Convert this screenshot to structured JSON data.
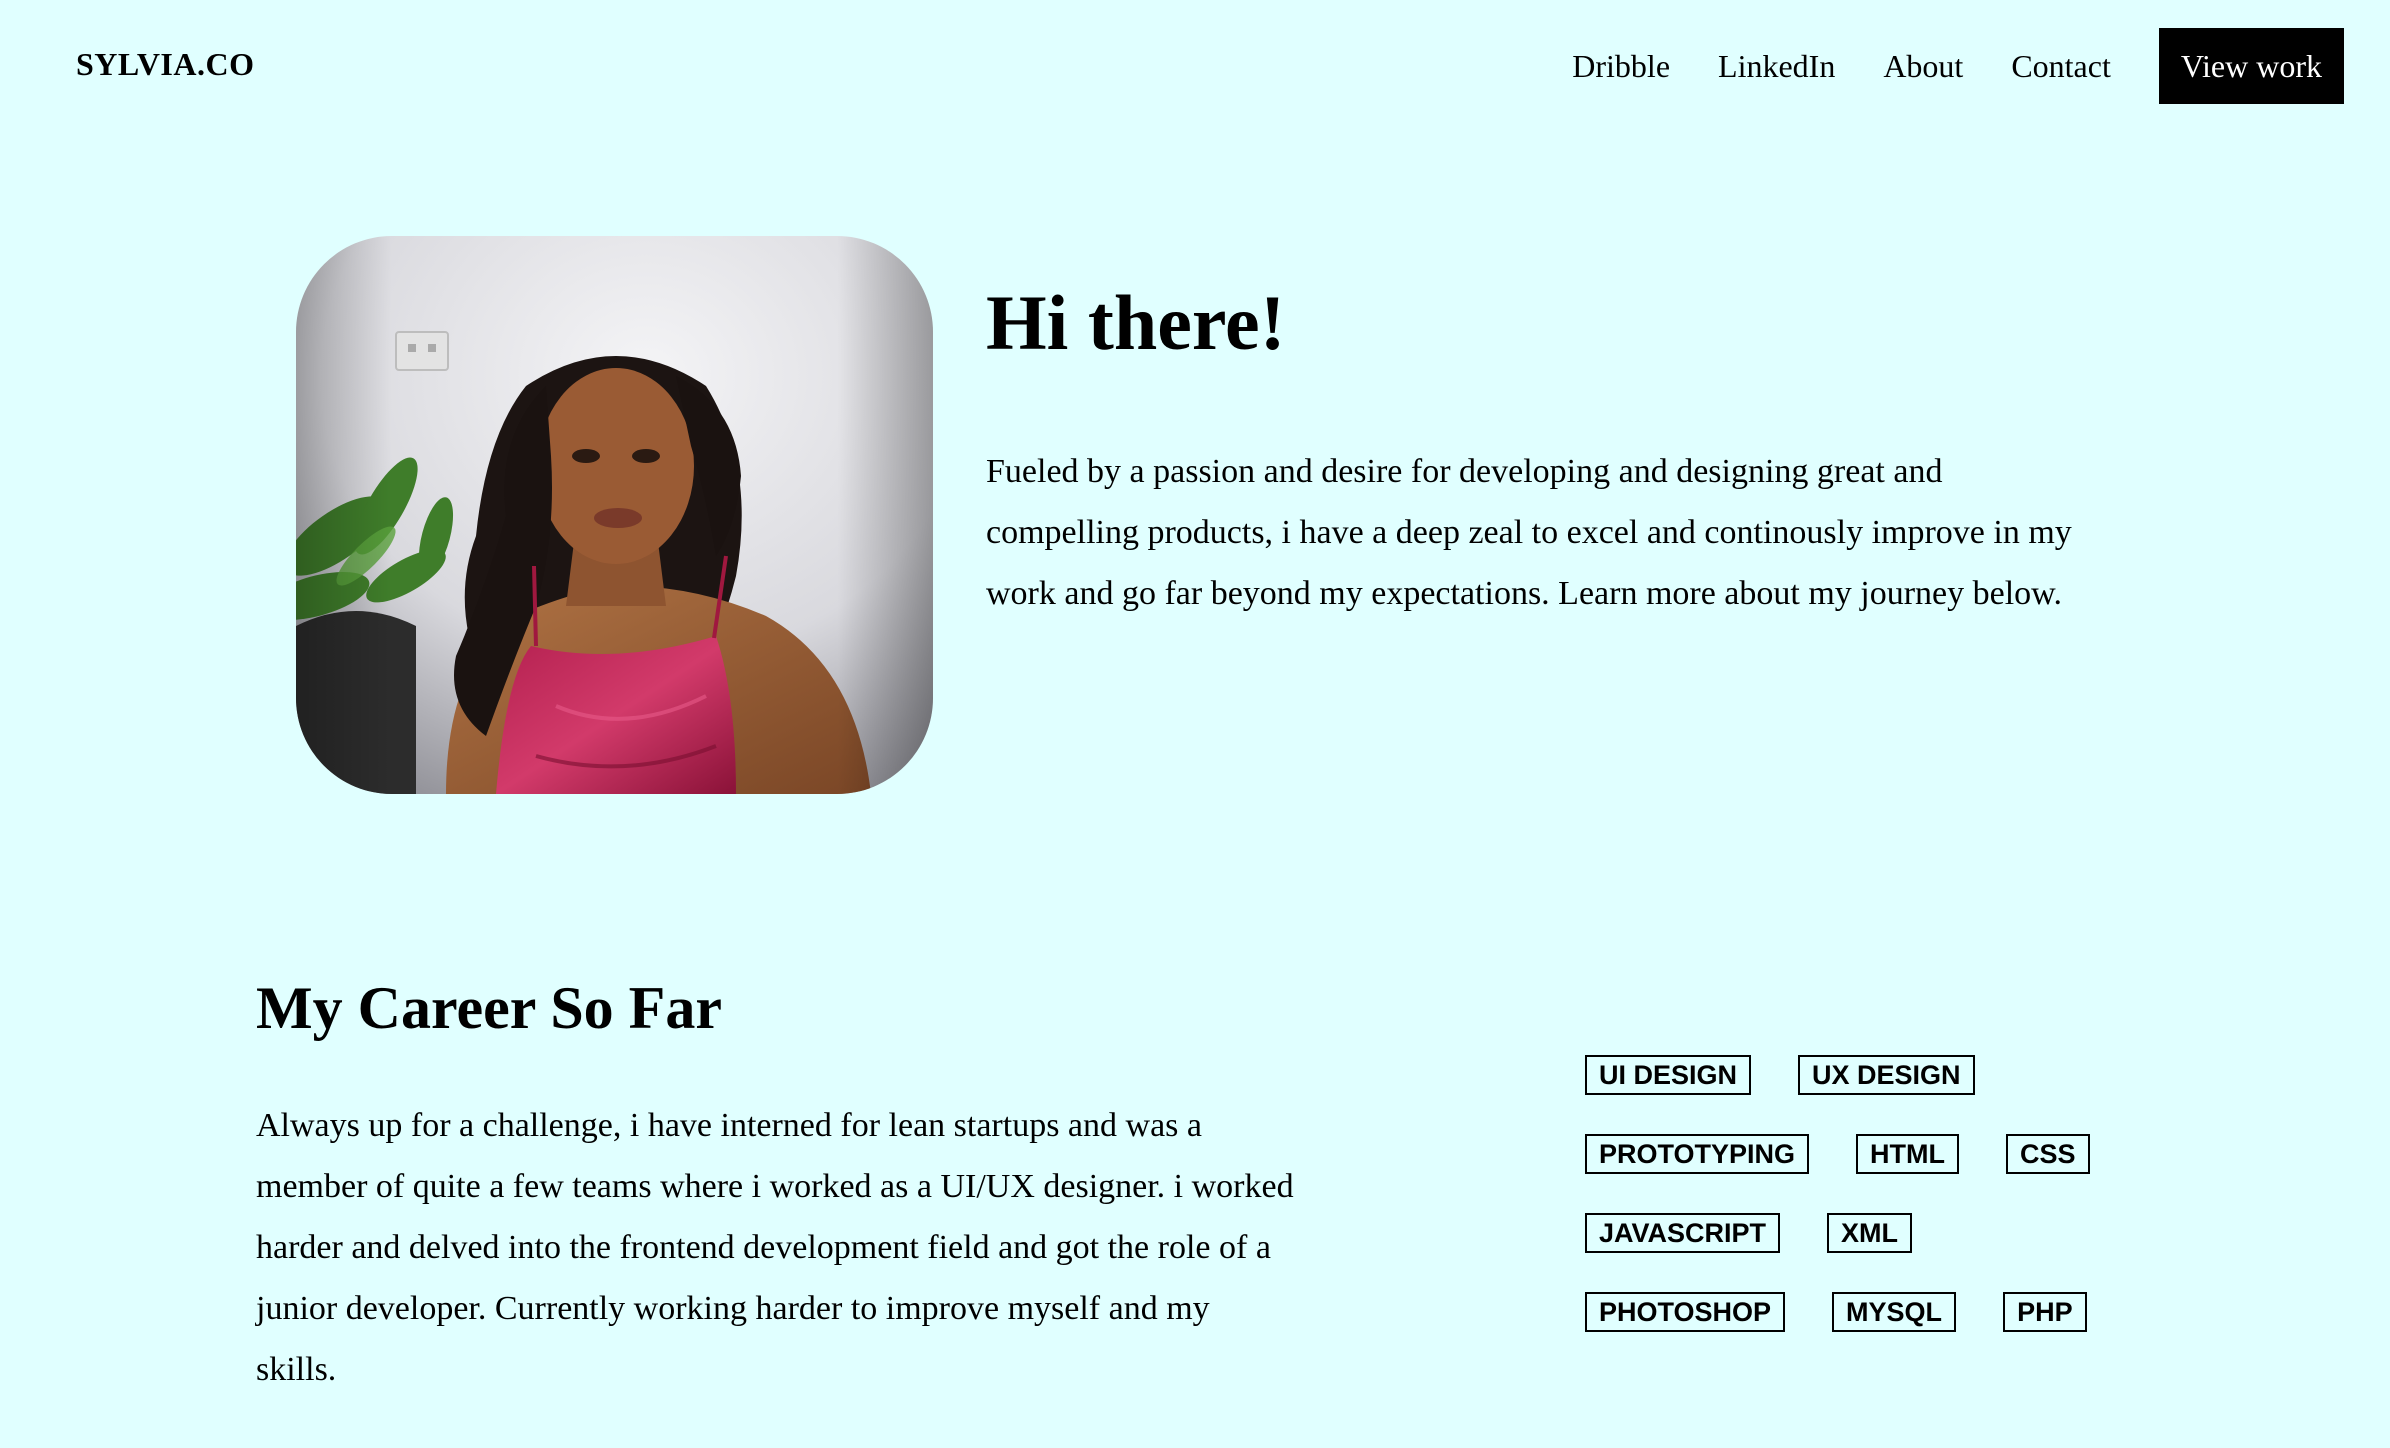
{
  "header": {
    "logo": "SYLVIA.CO",
    "nav": [
      "Dribble",
      "LinkedIn",
      "About",
      "Contact"
    ],
    "cta": "View work"
  },
  "hero": {
    "title": "Hi there!",
    "text": "Fueled by a passion and desire for developing and designing great and compelling products, i have a deep zeal to excel and continously improve in my work and go far beyond my expectations. Learn more about my journey below."
  },
  "career": {
    "title": "My Career So Far",
    "text": "Always up for a challenge, i have interned for lean startups and was a member of quite a few teams where i worked as a UI/UX designer. i worked harder and delved into the frontend development field and got the role of a junior developer. Currently working harder to improve myself and my skills.",
    "skills": [
      [
        "UI DESIGN",
        "UX DESIGN"
      ],
      [
        "PROTOTYPING",
        "HTML",
        "CSS"
      ],
      [
        "JAVASCRIPT",
        "XML"
      ],
      [
        "PHOTOSHOP",
        "MYSQL",
        "PHP"
      ]
    ]
  },
  "colors": {
    "background": "#e0ffff",
    "cta_background": "#000000",
    "cta_text": "#ffffff"
  }
}
